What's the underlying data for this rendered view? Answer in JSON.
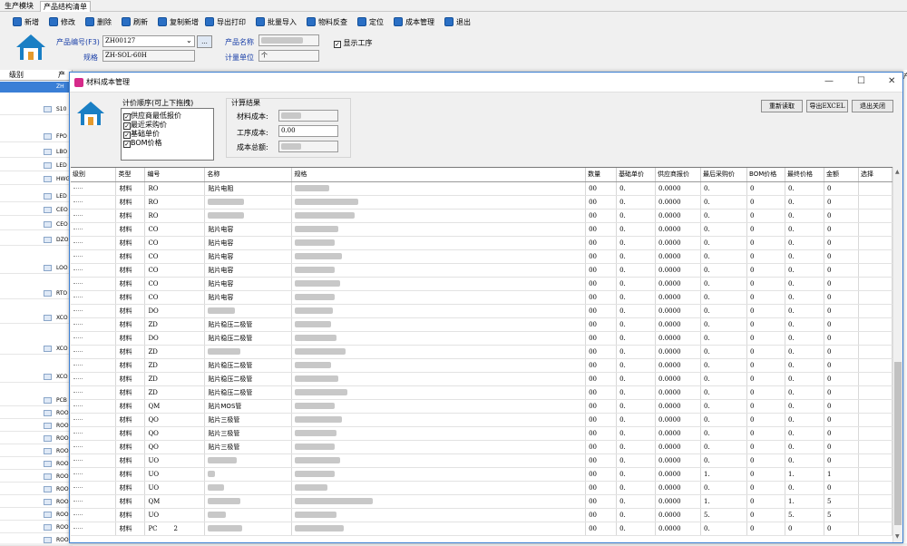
{
  "tabs": [
    {
      "label": "生产模块"
    },
    {
      "label": "产品结构清单"
    }
  ],
  "toolbar": [
    {
      "label": "新增"
    },
    {
      "label": "修改"
    },
    {
      "label": "删除"
    },
    {
      "label": "刷新"
    },
    {
      "label": "复制新增"
    },
    {
      "label": "导出打印"
    },
    {
      "label": "批量导入"
    },
    {
      "label": "物料反查"
    },
    {
      "label": "定位"
    },
    {
      "label": "成本管理"
    },
    {
      "label": "退出"
    }
  ],
  "header": {
    "product_code_label": "产品编号(F3)",
    "product_code_value": "ZH00127",
    "more_button": "...",
    "spec_label": "规格",
    "spec_value": "ZH-SOL-60H",
    "product_name_label": "产品名称",
    "unit_label": "计量单位",
    "unit_value": "个",
    "show_process_label": "显示工序"
  },
  "background_grid": {
    "level_header": "级别",
    "product_header": "产",
    "right_header": "产",
    "tree_codes": [
      "ZH",
      "S10",
      "FPO",
      "LBO",
      "LED",
      "HWG",
      "LED",
      "CEO",
      "CEO",
      "DZO",
      "LOO",
      "RTO",
      "XCO",
      "XCO",
      "XCO",
      "PCB",
      "ROO",
      "ROO",
      "ROO",
      "ROO",
      "ROO",
      "ROO",
      "ROO",
      "ROO",
      "ROO",
      "ROO",
      "ROO",
      "ROO"
    ]
  },
  "dialog": {
    "title": "材料成本管理",
    "order_title": "计价顺序(可上下拖拽)",
    "order_items": [
      {
        "label": "供应商最低报价",
        "checked": true
      },
      {
        "label": "最近采购价",
        "checked": true
      },
      {
        "label": "基础单价",
        "checked": true
      },
      {
        "label": "BOM价格",
        "checked": true
      }
    ],
    "result_title": "计算结果",
    "material_cost_label": "材料成本:",
    "process_cost_label": "工序成本:",
    "process_cost_value": "0.00",
    "total_cost_label": "成本总额:",
    "buttons": {
      "reload": "重新读取",
      "export": "导出EXCEL",
      "exit": "退出关闭"
    }
  },
  "grid": {
    "columns": [
      "级别",
      "类型",
      "编号",
      "名称",
      "规格",
      "数量",
      "基础单价",
      "供应商报价",
      "最后采购价",
      "BOM价格",
      "最终价格",
      "金额",
      "选择"
    ],
    "rows": [
      {
        "type": "材料",
        "code": "RO",
        "name": "贴片电阻",
        "qty": "00",
        "base": "0.",
        "supplier": "0.0000",
        "last": "0.",
        "bom": "0",
        "final": "0.",
        "amount": "0"
      },
      {
        "type": "材料",
        "code": "RO",
        "name": "",
        "qty": "00",
        "base": "0.",
        "supplier": "0.0000",
        "last": "0.",
        "bom": "0",
        "final": "0.",
        "amount": "0"
      },
      {
        "type": "材料",
        "code": "RO",
        "name": "",
        "qty": "00",
        "base": "0.",
        "supplier": "0.0000",
        "last": "0.",
        "bom": "0",
        "final": "0.",
        "amount": "0"
      },
      {
        "type": "材料",
        "code": "CO",
        "name": "贴片电容",
        "qty": "00",
        "base": "0.",
        "supplier": "0.0000",
        "last": "0.",
        "bom": "0",
        "final": "0.",
        "amount": "0"
      },
      {
        "type": "材料",
        "code": "CO",
        "name": "贴片电容",
        "qty": "00",
        "base": "0.",
        "supplier": "0.0000",
        "last": "0.",
        "bom": "0",
        "final": "0.",
        "amount": "0"
      },
      {
        "type": "材料",
        "code": "CO",
        "name": "贴片电容",
        "qty": "00",
        "base": "0.",
        "supplier": "0.0000",
        "last": "0.",
        "bom": "0",
        "final": "0.",
        "amount": "0"
      },
      {
        "type": "材料",
        "code": "CO",
        "name": "贴片电容",
        "qty": "00",
        "base": "0.",
        "supplier": "0.0000",
        "last": "0.",
        "bom": "0",
        "final": "0.",
        "amount": "0"
      },
      {
        "type": "材料",
        "code": "CO",
        "name": "贴片电容",
        "qty": "00",
        "base": "0.",
        "supplier": "0.0000",
        "last": "0.",
        "bom": "0",
        "final": "0.",
        "amount": "0"
      },
      {
        "type": "材料",
        "code": "CO",
        "name": "贴片电容",
        "qty": "00",
        "base": "0.",
        "supplier": "0.0000",
        "last": "0.",
        "bom": "0",
        "final": "0.",
        "amount": "0"
      },
      {
        "type": "材料",
        "code": "DO",
        "name": "",
        "qty": "00",
        "base": "0.",
        "supplier": "0.0000",
        "last": "0.",
        "bom": "0",
        "final": "0.",
        "amount": "0"
      },
      {
        "type": "材料",
        "code": "ZD",
        "name": "贴片稳压二极管",
        "qty": "00",
        "base": "0.",
        "supplier": "0.0000",
        "last": "0.",
        "bom": "0",
        "final": "0.",
        "amount": "0"
      },
      {
        "type": "材料",
        "code": "DO",
        "name": "贴片稳压二极管",
        "qty": "00",
        "base": "0.",
        "supplier": "0.0000",
        "last": "0.",
        "bom": "0",
        "final": "0.",
        "amount": "0"
      },
      {
        "type": "材料",
        "code": "ZD",
        "name": "",
        "qty": "00",
        "base": "0.",
        "supplier": "0.0000",
        "last": "0.",
        "bom": "0",
        "final": "0.",
        "amount": "0"
      },
      {
        "type": "材料",
        "code": "ZD",
        "name": "贴片稳压二极管",
        "qty": "00",
        "base": "0.",
        "supplier": "0.0000",
        "last": "0.",
        "bom": "0",
        "final": "0.",
        "amount": "0"
      },
      {
        "type": "材料",
        "code": "ZD",
        "name": "贴片稳压二极管",
        "qty": "00",
        "base": "0.",
        "supplier": "0.0000",
        "last": "0.",
        "bom": "0",
        "final": "0.",
        "amount": "0"
      },
      {
        "type": "材料",
        "code": "ZD",
        "name": "贴片稳压二极管",
        "qty": "00",
        "base": "0.",
        "supplier": "0.0000",
        "last": "0.",
        "bom": "0",
        "final": "0.",
        "amount": "0"
      },
      {
        "type": "材料",
        "code": "QM",
        "name": "贴片MOS管",
        "qty": "00",
        "base": "0.",
        "supplier": "0.0000",
        "last": "0.",
        "bom": "0",
        "final": "0.",
        "amount": "0"
      },
      {
        "type": "材料",
        "code": "QO",
        "name": "贴片三极管",
        "qty": "00",
        "base": "0.",
        "supplier": "0.0000",
        "last": "0.",
        "bom": "0",
        "final": "0.",
        "amount": "0"
      },
      {
        "type": "材料",
        "code": "QO",
        "name": "贴片三极管",
        "qty": "00",
        "base": "0.",
        "supplier": "0.0000",
        "last": "0.",
        "bom": "0",
        "final": "0.",
        "amount": "0"
      },
      {
        "type": "材料",
        "code": "QO",
        "name": "贴片三极管",
        "qty": "00",
        "base": "0.",
        "supplier": "0.0000",
        "last": "0.",
        "bom": "0",
        "final": "0.",
        "amount": "0"
      },
      {
        "type": "材料",
        "code": "UO",
        "name": "",
        "qty": "00",
        "base": "0.",
        "supplier": "0.0000",
        "last": "0.",
        "bom": "0",
        "final": "0.",
        "amount": "0"
      },
      {
        "type": "材料",
        "code": "UO",
        "name": "",
        "qty": "00",
        "base": "0.",
        "supplier": "0.0000",
        "last": "1.",
        "bom": "0",
        "final": "1.",
        "amount": "1"
      },
      {
        "type": "材料",
        "code": "UO",
        "name": "",
        "qty": "00",
        "base": "0.",
        "supplier": "0.0000",
        "last": "0.",
        "bom": "0",
        "final": "0.",
        "amount": "0"
      },
      {
        "type": "材料",
        "code": "QM",
        "name": "",
        "qty": "00",
        "base": "0.",
        "supplier": "0.0000",
        "last": "1.",
        "bom": "0",
        "final": "1.",
        "amount": "5"
      },
      {
        "type": "材料",
        "code": "UO",
        "name": "",
        "qty": "00",
        "base": "0.",
        "supplier": "0.0000",
        "last": "5.",
        "bom": "0",
        "final": "5.",
        "amount": "5"
      },
      {
        "type": "材料",
        "code": "PC",
        "code2": "2",
        "name": "",
        "qty": "00",
        "base": "0.",
        "supplier": "0.0000",
        "last": "0.",
        "bom": "0",
        "final": "0",
        "amount": "0"
      }
    ]
  }
}
